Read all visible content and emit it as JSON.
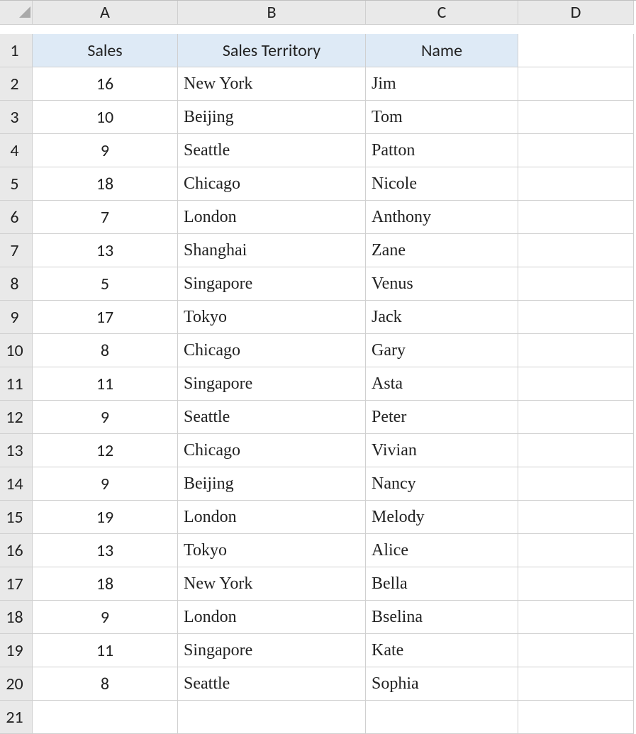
{
  "columns": [
    "A",
    "B",
    "C",
    "D"
  ],
  "row_numbers": [
    1,
    2,
    3,
    4,
    5,
    6,
    7,
    8,
    9,
    10,
    11,
    12,
    13,
    14,
    15,
    16,
    17,
    18,
    19,
    20,
    21
  ],
  "headers": {
    "a": "Sales",
    "b": "Sales Territory",
    "c": "Name"
  },
  "rows": [
    {
      "sales": "16",
      "territory": "New York",
      "name": "Jim"
    },
    {
      "sales": "10",
      "territory": "Beijing",
      "name": "Tom"
    },
    {
      "sales": "9",
      "territory": "Seattle",
      "name": "Patton"
    },
    {
      "sales": "18",
      "territory": "Chicago",
      "name": "Nicole"
    },
    {
      "sales": "7",
      "territory": "London",
      "name": "Anthony"
    },
    {
      "sales": "13",
      "territory": "Shanghai",
      "name": "Zane"
    },
    {
      "sales": "5",
      "territory": "Singapore",
      "name": "Venus"
    },
    {
      "sales": "17",
      "territory": "Tokyo",
      "name": "Jack"
    },
    {
      "sales": "8",
      "territory": "Chicago",
      "name": "Gary"
    },
    {
      "sales": "11",
      "territory": "Singapore",
      "name": "Asta"
    },
    {
      "sales": "9",
      "territory": "Seattle",
      "name": "Peter"
    },
    {
      "sales": "12",
      "territory": "Chicago",
      "name": "Vivian"
    },
    {
      "sales": "9",
      "territory": "Beijing",
      "name": "Nancy"
    },
    {
      "sales": "19",
      "territory": "London",
      "name": "Melody"
    },
    {
      "sales": "13",
      "territory": "Tokyo",
      "name": "Alice"
    },
    {
      "sales": "18",
      "territory": "New York",
      "name": "Bella"
    },
    {
      "sales": "9",
      "territory": "London",
      "name": "Bselina"
    },
    {
      "sales": "11",
      "territory": "Singapore",
      "name": "Kate"
    },
    {
      "sales": "8",
      "territory": "Seattle",
      "name": "Sophia"
    }
  ],
  "chart_data": {
    "type": "table",
    "title": "",
    "columns": [
      "Sales",
      "Sales Territory",
      "Name"
    ],
    "data": [
      [
        16,
        "New York",
        "Jim"
      ],
      [
        10,
        "Beijing",
        "Tom"
      ],
      [
        9,
        "Seattle",
        "Patton"
      ],
      [
        18,
        "Chicago",
        "Nicole"
      ],
      [
        7,
        "London",
        "Anthony"
      ],
      [
        13,
        "Shanghai",
        "Zane"
      ],
      [
        5,
        "Singapore",
        "Venus"
      ],
      [
        17,
        "Tokyo",
        "Jack"
      ],
      [
        8,
        "Chicago",
        "Gary"
      ],
      [
        11,
        "Singapore",
        "Asta"
      ],
      [
        9,
        "Seattle",
        "Peter"
      ],
      [
        12,
        "Chicago",
        "Vivian"
      ],
      [
        9,
        "Beijing",
        "Nancy"
      ],
      [
        19,
        "London",
        "Melody"
      ],
      [
        13,
        "Tokyo",
        "Alice"
      ],
      [
        18,
        "New York",
        "Bella"
      ],
      [
        9,
        "London",
        "Bselina"
      ],
      [
        11,
        "Singapore",
        "Kate"
      ],
      [
        8,
        "Seattle",
        "Sophia"
      ]
    ]
  }
}
